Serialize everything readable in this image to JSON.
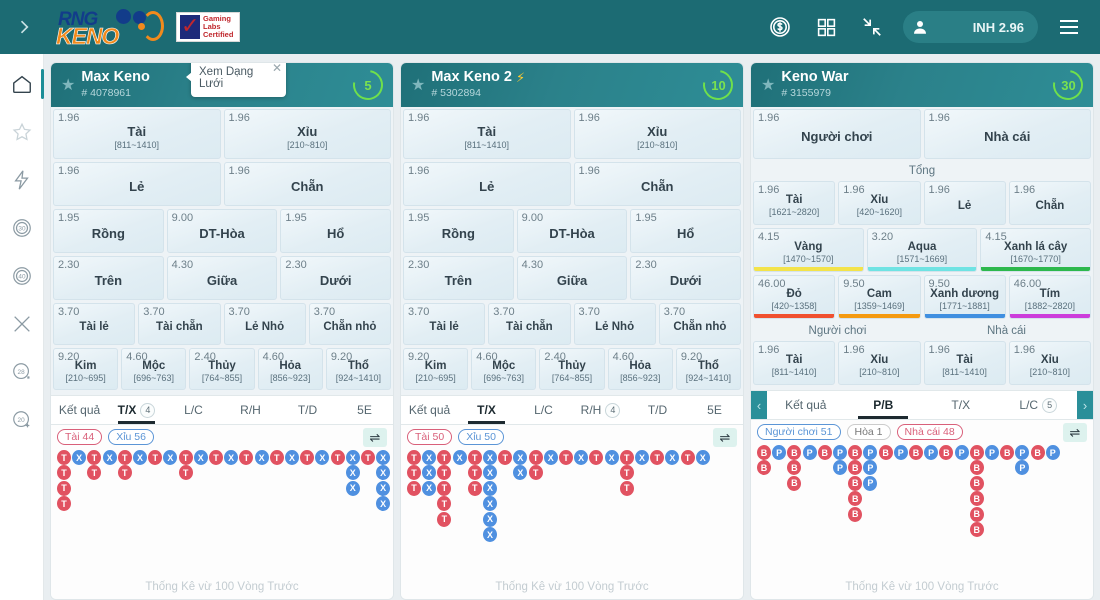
{
  "topbar": {
    "expand_icon": "chevron-right-icon",
    "logo_rng": "RNG",
    "logo_keno": "KENO",
    "cert_line1": "Gaming",
    "cert_line2": "Labs",
    "cert_line3": "Certified",
    "coin_icon": "coin-dollar-icon",
    "grid_icon": "grid-apps-icon",
    "shrink_icon": "shrink-arrows-icon",
    "avatar_icon": "user-avatar-icon",
    "balance": "INH 2.96",
    "menu_icon": "hamburger-menu-icon"
  },
  "sidebar": {
    "items": [
      {
        "name": "home",
        "icon": "home-icon",
        "label": "",
        "active": true
      },
      {
        "name": "favorites",
        "icon": "star-icon",
        "label": ""
      },
      {
        "name": "fast-games",
        "icon": "lightning-icon",
        "label": ""
      },
      {
        "name": "keno-30",
        "icon": "circle-30-icon",
        "label": "30"
      },
      {
        "name": "keno-40",
        "icon": "circle-40-icon",
        "label": "40"
      },
      {
        "name": "war",
        "icon": "crossed-swords-icon",
        "label": ""
      },
      {
        "name": "keno-28",
        "icon": "circle-28-icon",
        "label": "28"
      },
      {
        "name": "keno-20",
        "icon": "circle-20-icon",
        "label": "20"
      }
    ]
  },
  "tooltip": {
    "text": "Xem Dạng Lưới",
    "close_icon": "close-icon"
  },
  "cards": [
    {
      "title": "Max Keno",
      "id": "# 4078961",
      "bolt": false,
      "timer": "5",
      "star_icon": "star-icon",
      "rows": [
        {
          "type": "bets",
          "h": "h50",
          "items": [
            {
              "odd": "1.96",
              "name": "Tài",
              "range": "[811~1410]"
            },
            {
              "odd": "1.96",
              "name": "Xỉu",
              "range": "[210~810]"
            }
          ]
        },
        {
          "type": "bets",
          "h": "h44",
          "items": [
            {
              "odd": "1.96",
              "name": "Lẻ",
              "range": ""
            },
            {
              "odd": "1.96",
              "name": "Chẵn",
              "range": ""
            }
          ]
        },
        {
          "type": "bets",
          "h": "h44",
          "items": [
            {
              "odd": "1.95",
              "name": "Rồng",
              "range": ""
            },
            {
              "odd": "9.00",
              "name": "DT-Hòa",
              "range": ""
            },
            {
              "odd": "1.95",
              "name": "Hổ",
              "range": ""
            }
          ]
        },
        {
          "type": "bets",
          "h": "h44",
          "items": [
            {
              "odd": "2.30",
              "name": "Trên",
              "range": ""
            },
            {
              "odd": "4.30",
              "name": "Giữa",
              "range": ""
            },
            {
              "odd": "2.30",
              "name": "Dưới",
              "range": ""
            }
          ]
        },
        {
          "type": "bets",
          "h": "h42",
          "items": [
            {
              "odd": "3.70",
              "name": "Tài lẻ",
              "range": "",
              "small": true
            },
            {
              "odd": "3.70",
              "name": "Tài chẵn",
              "range": "",
              "small": true
            },
            {
              "odd": "3.70",
              "name": "Lẻ Nhỏ",
              "range": "",
              "small": true
            },
            {
              "odd": "3.70",
              "name": "Chẵn nhỏ",
              "range": "",
              "small": true
            }
          ]
        },
        {
          "type": "bets",
          "h": "h42",
          "items": [
            {
              "odd": "9.20",
              "name": "Kim",
              "range": "[210~695]",
              "small": true
            },
            {
              "odd": "4.60",
              "name": "Mộc",
              "range": "[696~763]",
              "small": true
            },
            {
              "odd": "2.40",
              "name": "Thủy",
              "range": "[764~855]",
              "small": true
            },
            {
              "odd": "4.60",
              "name": "Hỏa",
              "range": "[856~923]",
              "small": true
            },
            {
              "odd": "9.20",
              "name": "Thổ",
              "range": "[924~1410]",
              "small": true
            }
          ]
        }
      ],
      "tabs": [
        {
          "label": "Kết quả",
          "badge": "",
          "active": false
        },
        {
          "label": "T/X",
          "badge": "4",
          "active": true
        },
        {
          "label": "L/C",
          "badge": "",
          "active": false
        },
        {
          "label": "R/H",
          "badge": "",
          "active": false
        },
        {
          "label": "T/D",
          "badge": "",
          "active": false
        },
        {
          "label": "5E",
          "badge": "",
          "active": false
        }
      ],
      "arrows": false,
      "chips": [
        {
          "text": "Tài 44",
          "style": "red"
        },
        {
          "text": "Xỉu 56",
          "style": "blue"
        }
      ],
      "swap_icon": "swap-arrows-icon",
      "road_note": "Thống Kê vừ 100 Vòng Trước",
      "road_columns": [
        [
          "r:T",
          "r:T",
          "r:T",
          "r:T"
        ],
        [
          "b:X"
        ],
        [
          "r:T",
          "r:T"
        ],
        [
          "b:X"
        ],
        [
          "r:T",
          "r:T"
        ],
        [
          "b:X"
        ],
        [
          "r:T"
        ],
        [
          "b:X"
        ],
        [
          "r:T",
          "r:T"
        ],
        [
          "b:X"
        ],
        [
          "r:T"
        ],
        [
          "b:X"
        ],
        [
          "r:T"
        ],
        [
          "b:X"
        ],
        [
          "r:T"
        ],
        [
          "b:X"
        ],
        [
          "r:T"
        ],
        [
          "b:X"
        ],
        [
          "r:T"
        ],
        [
          "b:X",
          "b:X",
          "b:X"
        ],
        [
          "r:T"
        ],
        [
          "b:X",
          "b:X",
          "b:X",
          "b:X"
        ]
      ]
    },
    {
      "title": "Max Keno 2",
      "id": "# 5302894",
      "bolt": true,
      "timer": "10",
      "star_icon": "star-icon",
      "rows": [
        {
          "type": "bets",
          "h": "h50",
          "items": [
            {
              "odd": "1.96",
              "name": "Tài",
              "range": "[811~1410]"
            },
            {
              "odd": "1.96",
              "name": "Xỉu",
              "range": "[210~810]"
            }
          ]
        },
        {
          "type": "bets",
          "h": "h44",
          "items": [
            {
              "odd": "1.96",
              "name": "Lẻ",
              "range": ""
            },
            {
              "odd": "1.96",
              "name": "Chẵn",
              "range": ""
            }
          ]
        },
        {
          "type": "bets",
          "h": "h44",
          "items": [
            {
              "odd": "1.95",
              "name": "Rồng",
              "range": ""
            },
            {
              "odd": "9.00",
              "name": "DT-Hòa",
              "range": ""
            },
            {
              "odd": "1.95",
              "name": "Hổ",
              "range": ""
            }
          ]
        },
        {
          "type": "bets",
          "h": "h44",
          "items": [
            {
              "odd": "2.30",
              "name": "Trên",
              "range": ""
            },
            {
              "odd": "4.30",
              "name": "Giữa",
              "range": ""
            },
            {
              "odd": "2.30",
              "name": "Dưới",
              "range": ""
            }
          ]
        },
        {
          "type": "bets",
          "h": "h42",
          "items": [
            {
              "odd": "3.70",
              "name": "Tài lẻ",
              "range": "",
              "small": true
            },
            {
              "odd": "3.70",
              "name": "Tài chẵn",
              "range": "",
              "small": true
            },
            {
              "odd": "3.70",
              "name": "Lẻ Nhỏ",
              "range": "",
              "small": true
            },
            {
              "odd": "3.70",
              "name": "Chẵn nhỏ",
              "range": "",
              "small": true
            }
          ]
        },
        {
          "type": "bets",
          "h": "h42",
          "items": [
            {
              "odd": "9.20",
              "name": "Kim",
              "range": "[210~695]",
              "small": true
            },
            {
              "odd": "4.60",
              "name": "Mộc",
              "range": "[696~763]",
              "small": true
            },
            {
              "odd": "2.40",
              "name": "Thủy",
              "range": "[764~855]",
              "small": true
            },
            {
              "odd": "4.60",
              "name": "Hỏa",
              "range": "[856~923]",
              "small": true
            },
            {
              "odd": "9.20",
              "name": "Thổ",
              "range": "[924~1410]",
              "small": true
            }
          ]
        }
      ],
      "tabs": [
        {
          "label": "Kết quả",
          "badge": "",
          "active": false
        },
        {
          "label": "T/X",
          "badge": "",
          "active": true
        },
        {
          "label": "L/C",
          "badge": "",
          "active": false
        },
        {
          "label": "R/H",
          "badge": "4",
          "active": false
        },
        {
          "label": "T/D",
          "badge": "",
          "active": false
        },
        {
          "label": "5E",
          "badge": "",
          "active": false
        }
      ],
      "arrows": false,
      "chips": [
        {
          "text": "Tài 50",
          "style": "red"
        },
        {
          "text": "Xỉu 50",
          "style": "blue"
        }
      ],
      "swap_icon": "swap-arrows-icon",
      "road_note": "Thống Kê vừ 100 Vòng Trước",
      "road_columns": [
        [
          "r:T",
          "r:T",
          "r:T"
        ],
        [
          "b:X",
          "b:X",
          "b:X"
        ],
        [
          "r:T",
          "r:T",
          "r:T",
          "r:T",
          "r:T"
        ],
        [
          "b:X"
        ],
        [
          "r:T",
          "r:T",
          "r:T"
        ],
        [
          "b:X",
          "b:X",
          "b:X",
          "b:X",
          "b:X",
          "b:X"
        ],
        [
          "r:T"
        ],
        [
          "b:X",
          "b:X"
        ],
        [
          "r:T",
          "r:T"
        ],
        [
          "b:X"
        ],
        [
          "r:T"
        ],
        [
          "b:X"
        ],
        [
          "r:T"
        ],
        [
          "b:X"
        ],
        [
          "r:T",
          "r:T",
          "r:T"
        ],
        [
          "b:X"
        ],
        [
          "r:T"
        ],
        [
          "b:X"
        ],
        [
          "r:T"
        ],
        [
          "b:X"
        ]
      ]
    },
    {
      "title": "Keno War",
      "id": "# 3155979",
      "bolt": false,
      "timer": "30",
      "star_icon": "star-icon",
      "rows": [
        {
          "type": "bets",
          "h": "h50",
          "items": [
            {
              "odd": "1.96",
              "name": "Người chơi",
              "range": ""
            },
            {
              "odd": "1.96",
              "name": "Nhà cái",
              "range": ""
            }
          ]
        },
        {
          "type": "label",
          "text": "Tổng"
        },
        {
          "type": "bets",
          "h": "h44",
          "items": [
            {
              "odd": "1.96",
              "name": "Tài",
              "range": "[1621~2820]",
              "small": true
            },
            {
              "odd": "1.96",
              "name": "Xỉu",
              "range": "[420~1620]",
              "small": true
            },
            {
              "odd": "1.96",
              "name": "Lẻ",
              "range": "",
              "small": true
            },
            {
              "odd": "1.96",
              "name": "Chẵn",
              "range": "",
              "small": true
            }
          ]
        },
        {
          "type": "bets",
          "h": "h44",
          "items": [
            {
              "odd": "4.15",
              "name": "Vàng",
              "range": "[1470~1570]",
              "small": true,
              "bar": "#f3e34a"
            },
            {
              "odd": "3.20",
              "name": "Aqua",
              "range": "[1571~1669]",
              "small": true,
              "bar": "#6fe3e3"
            },
            {
              "odd": "4.15",
              "name": "Xanh lá cây",
              "range": "[1670~1770]",
              "small": true,
              "bar": "#2db84d"
            }
          ]
        },
        {
          "type": "bets",
          "h": "h44",
          "items": [
            {
              "odd": "46.00",
              "name": "Đỏ",
              "range": "[420~1358]",
              "small": true,
              "bar": "#f0502f"
            },
            {
              "odd": "9.50",
              "name": "Cam",
              "range": "[1359~1469]",
              "small": true,
              "bar": "#f49a10"
            },
            {
              "odd": "9.50",
              "name": "Xanh dương",
              "range": "[1771~1881]",
              "small": true,
              "bar": "#3f8fe0"
            },
            {
              "odd": "46.00",
              "name": "Tím",
              "range": "[1882~2820]",
              "small": true,
              "bar": "#cc3ddb"
            }
          ]
        },
        {
          "type": "split-label",
          "left": "Người chơi",
          "right": "Nhà cái"
        },
        {
          "type": "bets",
          "h": "h44",
          "items": [
            {
              "odd": "1.96",
              "name": "Tài",
              "range": "[811~1410]",
              "small": true
            },
            {
              "odd": "1.96",
              "name": "Xỉu",
              "range": "[210~810]",
              "small": true
            },
            {
              "odd": "1.96",
              "name": "Tài",
              "range": "[811~1410]",
              "small": true
            },
            {
              "odd": "1.96",
              "name": "Xỉu",
              "range": "[210~810]",
              "small": true
            }
          ]
        }
      ],
      "tabs": [
        {
          "label": "Kết quả",
          "badge": "",
          "active": false
        },
        {
          "label": "P/B",
          "badge": "",
          "active": true
        },
        {
          "label": "T/X",
          "badge": "",
          "active": false
        },
        {
          "label": "L/C",
          "badge": "5",
          "active": false
        }
      ],
      "arrows": true,
      "left_arrow_icon": "chevron-left-icon",
      "right_arrow_icon": "chevron-right-icon",
      "chips": [
        {
          "text": "Người chơi 51",
          "style": "blue"
        },
        {
          "text": "Hòa 1",
          "style": ""
        },
        {
          "text": "Nhà cái 48",
          "style": "red"
        }
      ],
      "swap_icon": "swap-arrows-icon",
      "road_note": "Thống Kê vừ 100 Vòng Trước",
      "road_columns": [
        [
          "r:B",
          "r:B"
        ],
        [
          "b:P"
        ],
        [
          "r:B",
          "r:B",
          "r:B"
        ],
        [
          "b:P"
        ],
        [
          "r:B"
        ],
        [
          "b:P",
          "b:P"
        ],
        [
          "r:B",
          "r:B",
          "r:B",
          "r:B",
          "r:B"
        ],
        [
          "b:P",
          "b:P",
          "b:P"
        ],
        [
          "r:B"
        ],
        [
          "b:P"
        ],
        [
          "r:B"
        ],
        [
          "b:P"
        ],
        [
          "r:B"
        ],
        [
          "b:P"
        ],
        [
          "r:B",
          "r:B",
          "r:B",
          "r:B",
          "r:B",
          "r:B"
        ],
        [
          "b:P"
        ],
        [
          "r:B"
        ],
        [
          "b:P",
          "b:P"
        ],
        [
          "r:B"
        ],
        [
          "b:P"
        ]
      ]
    }
  ]
}
